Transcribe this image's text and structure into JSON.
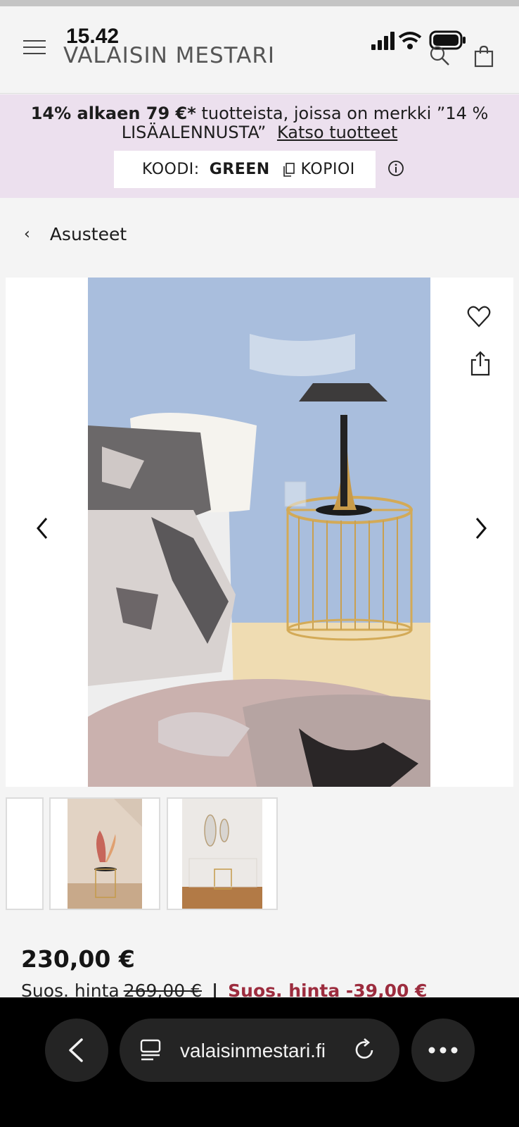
{
  "status": {
    "time": "15.42"
  },
  "header": {
    "logo_text": "VALAISIN MESTARI",
    "menu_icon": "hamburger-icon",
    "search_icon": "search-icon",
    "cart_icon": "shopping-bag-icon"
  },
  "promo": {
    "bold": "14% alkaen 79 €*",
    "text": "tuotteista, joissa on merkki ”14 % LISÄALENNUSTA”",
    "link": "Katso tuotteet",
    "code_label": "KOODI:",
    "code_value": "GREEN",
    "copy_label": "KOPIOI",
    "background": "#ece0ee"
  },
  "breadcrumb": {
    "label": "Asusteet"
  },
  "gallery": {
    "actions": [
      "heart-icon",
      "share-icon"
    ],
    "nav": [
      "chevron-left-icon",
      "chevron-right-icon"
    ]
  },
  "price": {
    "current": "230,00 €",
    "rec_label": "Suos. hinta",
    "rec_value": "269,00 €",
    "separator": "|",
    "saving": "Suos. hinta -39,00 €",
    "saving_color": "#9c2c3e"
  },
  "browser": {
    "url": "valaisinmestari.fi"
  }
}
